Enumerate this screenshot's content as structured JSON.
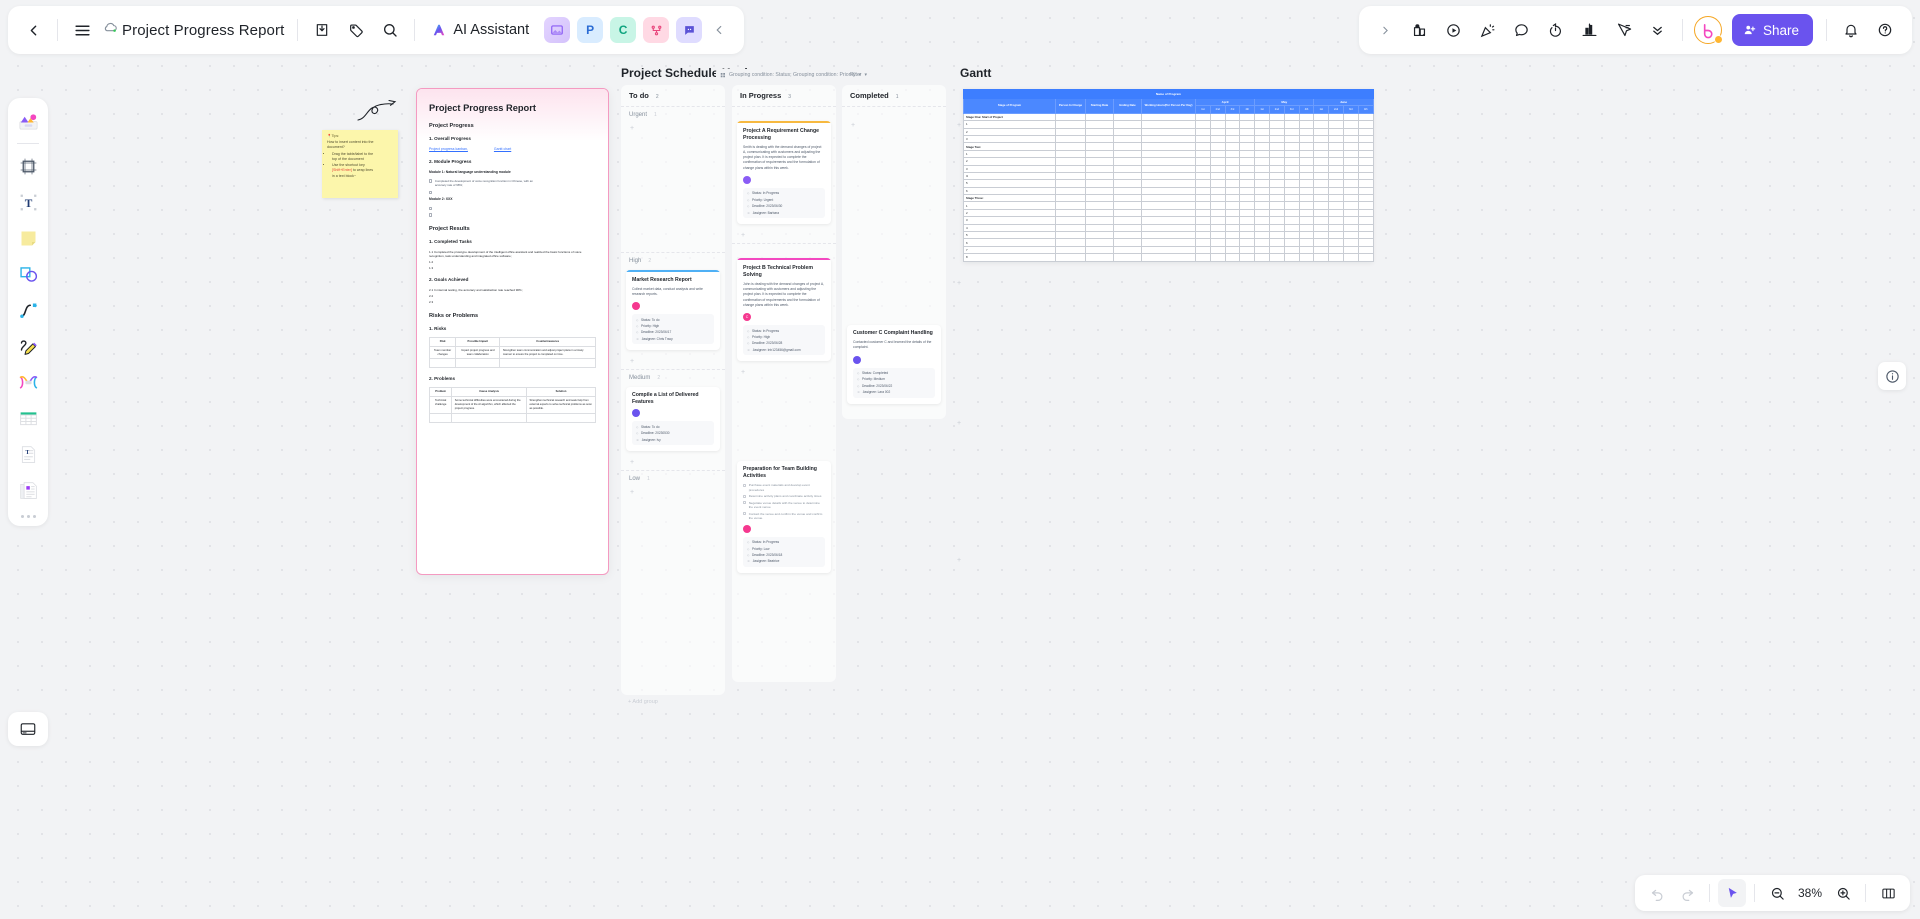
{
  "topbar": {
    "back_icon": "chevron-left-icon",
    "menu_icon": "hamburger-menu-icon",
    "cloud_icon": "cloud-sync-icon",
    "title": "Project Progress Report",
    "download_icon": "download-icon",
    "tag_icon": "tag-icon",
    "search_icon": "search-icon",
    "ai_label": "AI Assistant",
    "apps": [
      {
        "name": "app-image",
        "glyph": "◢"
      },
      {
        "name": "app-presentation",
        "glyph": "P"
      },
      {
        "name": "app-chart",
        "glyph": "C"
      },
      {
        "name": "app-mindmap",
        "glyph": "⑂"
      },
      {
        "name": "app-comment",
        "glyph": "••"
      }
    ],
    "collapse_icon": "chevron-left-icon",
    "right_expand_icon": "chevron-right-icon",
    "right_tools": [
      "sticker-icon",
      "play-circle-icon",
      "celebrate-icon",
      "comment-bubble-icon",
      "timer-icon",
      "presentation-chart-icon",
      "cursor-select-icon",
      "chevron-double-down-icon"
    ],
    "bot_icon": "bot-avatar",
    "share_label": "Share",
    "share_color": "#6a53ee",
    "bell_icon": "bell-icon",
    "help_icon": "help-circle-icon"
  },
  "tool_rail": {
    "items": [
      {
        "name": "templates-tool",
        "label": "Templates"
      },
      {
        "name": "frame-tool",
        "label": "Frame"
      },
      {
        "name": "text-tool",
        "label": "Text"
      },
      {
        "name": "sticky-note-tool",
        "label": "Sticky note"
      },
      {
        "name": "shape-tool",
        "label": "Shape"
      },
      {
        "name": "connector-tool",
        "label": "Connector"
      },
      {
        "name": "pen-tool",
        "label": "Pen"
      },
      {
        "name": "mindmap-tool",
        "label": "Mind map"
      },
      {
        "name": "table-tool",
        "label": "Table"
      },
      {
        "name": "document-tool",
        "label": "Document"
      },
      {
        "name": "more-apps-tool",
        "label": "More"
      }
    ],
    "more_icon": "three-dots-icon",
    "bottom_icon": "layers-panel-icon",
    "info_icon": "info-circle-icon"
  },
  "sticky_note": {
    "head": "📍Tips:",
    "line1": "How to insert content into the",
    "line2": "document?",
    "bullets": [
      {
        "pre": "Drag the table/label to the",
        "post": "top of the document"
      },
      {
        "pre": "Use the shortcut key",
        "key": "[Shift+Enter]",
        "post": " to wrap lines",
        "post2": "in a text block~"
      }
    ]
  },
  "document": {
    "title": "Project Progress Report",
    "h_progress": "Project Progress",
    "s1": "1. Overall Progress",
    "link1": "Project progress kanban,",
    "link2": "Gantt chart",
    "s2": "2. Module Progress",
    "module1": "Module 1: Natural language understanding module",
    "task1_a": "Completed the development of voice recognition function in Chinese, with an",
    "task1_b": "accuracy rate of 98%;",
    "module2": "Module 2: XXX",
    "h_results": "Project Results",
    "r1": "1. Completed Tasks",
    "r11": "1.1 Completed the prototype development of the intelligent office assistant and realized the basic functions of voice recognition, task understanding and integrated office software;",
    "r12": "1.2",
    "r13": "1.3",
    "r2": "2. Goals Achieved",
    "r21": "2.1 In internal testing, the accuracy and satisfaction rate reached 90%;",
    "r22": "2.2",
    "r23": "2.3",
    "h_risks": "Risks or Problems",
    "k1": "1. Risks",
    "risk_table": {
      "headers": [
        "Risk",
        "Possible Impact",
        "Countermeasures"
      ],
      "rows": [
        [
          "Team member changes",
          "Impact project progress and team collaboration",
          "Strengthen team communication and adjust project plans in a timely manner to ensure the project is completed on time."
        ],
        [
          "",
          "",
          ""
        ]
      ]
    },
    "k2": "2. Problems",
    "problem_table": {
      "headers": [
        "Problem",
        "Cause Analysis",
        "Solution"
      ],
      "rows": [
        [
          "Technical challenge",
          "Some technical difficulties were encountered during the development of the AI algorithm, which affected the project progress.",
          "Strengthen technical research and seek help from external experts to solve technical problems as soon as possible."
        ],
        [
          "",
          "",
          ""
        ]
      ]
    }
  },
  "kanban": {
    "title": "Project Schedule Kanban",
    "grouping_chip": "Grouping condition: Status; Grouping condition: Priority",
    "grouping_icon": "grouping-icon",
    "filter_label": "Filter",
    "add_group_label": "+ Add group",
    "columns": [
      {
        "name": "to-do",
        "title": "To do",
        "count": "2",
        "groups": [
          {
            "label": "Urgent",
            "count": "1",
            "cards": []
          },
          {
            "label": "High",
            "count": "2",
            "cards": [
              {
                "title": "Market Research Report",
                "desc": "Collect market data, conduct analysis and write research reports.",
                "accent": "#4fb0f5",
                "avatar_color": "#f5388f",
                "avatar_glyph": "◉",
                "meta": [
                  "Status: To do",
                  "Priority: High",
                  "Deadline: 2023/06/17",
                  "Assignee: Chris Tracy"
                ]
              }
            ]
          },
          {
            "label": "Medium",
            "count": "2",
            "cards": [
              {
                "title": "Compile a List of Delivered Features",
                "desc": "",
                "accent": "#ffffff",
                "avatar_color": "#6a53ee",
                "avatar_glyph": "▣",
                "meta": [
                  "Status: To do",
                  "Deadline: 20230530",
                  "Assignee: Ivy"
                ]
              }
            ]
          },
          {
            "label": "Low",
            "count": "1",
            "cards": []
          }
        ]
      },
      {
        "name": "in-progress",
        "title": "In Progress",
        "count": "3",
        "groups": [
          {
            "label": "",
            "count": "",
            "cards": [
              {
                "title": "Project A Requirement Change Processing",
                "desc": "Smith is dealing with the demand changes of project A, communicating with customers and adjusting the project plan. It is expected to complete the confirmation of requirements and the formulation of change plans within this week.",
                "accent": "#f7b940",
                "avatar_color": "#8a5cf5",
                "avatar_glyph": "▣",
                "meta": [
                  "Status: In Progress",
                  "Priority: Urgent",
                  "Deadline: 2023/06/30",
                  "Assignee: Barbara"
                ]
              }
            ]
          },
          {
            "label": "",
            "count": "",
            "cards": [
              {
                "title": "Project B Technical Problem Solving",
                "desc": "John is dealing with the demand changes of project A, communicating with customers and adjusting the project plan. It is expected to complete the confirmation of requirements and the formulation of change plans within this week.",
                "accent": "#f348c0",
                "avatar_color": "#f5388f",
                "avatar_glyph": "C",
                "meta": [
                  "Status: In Progress",
                  "Priority: High",
                  "Deadline: 2023/06/28",
                  "Assignee: Intr123456@gmail.com"
                ]
              }
            ]
          },
          {
            "label": "",
            "count": "",
            "cards": [
              {
                "title": "Preparation for Team Building Activities",
                "desc": "",
                "accent": "#ffffff",
                "avatar_color": "#f5388f",
                "avatar_glyph": "◉",
                "todos": [
                  "Purchase event materials and develop event procedures",
                  "Determine activity plans and coordinate activity times",
                  "Negotiate venue details with the venue to determine the event venue",
                  "Contact the venue and confirm the venue and confirm the venue."
                ],
                "meta": [
                  "Status: In Progress",
                  "Priority: Low",
                  "Deadline: 2023/06/18",
                  "Assignee: Beatrice"
                ]
              }
            ]
          }
        ]
      },
      {
        "name": "completed",
        "title": "Completed",
        "count": "1",
        "groups": [
          {
            "label": "",
            "count": "",
            "cards": []
          },
          {
            "label": "",
            "count": "",
            "cards": [
              {
                "title": "Customer C Complaint Handling",
                "desc": "Contacted customer C and learned the details of the complaint.",
                "accent": "#ffffff",
                "avatar_color": "#6a53ee",
                "avatar_glyph": "▣",
                "meta": [
                  "Status: Completed",
                  "Priority: Medium",
                  "Deadline: 2023/06/22",
                  "Assignee: Lara 002"
                ]
              }
            ]
          }
        ]
      }
    ]
  },
  "gantt": {
    "title": "Gantt",
    "banner": "Name of Program",
    "headers": [
      "Stage of Program",
      "Person In Charge",
      "Starting Date",
      "Ending Date",
      "Working Hours(Per Person Per Day)"
    ],
    "months": [
      "April",
      "May",
      "June"
    ],
    "ticks": [
      "1st",
      "2nd",
      "3rd",
      "4th",
      "1st",
      "2nd",
      "3rd",
      "4th",
      "1st",
      "2nd",
      "3rd",
      "4th"
    ],
    "rows": [
      {
        "type": "stage",
        "label": "Stage One: Start of Project"
      },
      {
        "type": "item",
        "label": "1"
      },
      {
        "type": "item",
        "label": "2"
      },
      {
        "type": "item",
        "label": "3"
      },
      {
        "type": "stage",
        "label": "Stage Two:"
      },
      {
        "type": "item",
        "label": "1"
      },
      {
        "type": "item",
        "label": "2"
      },
      {
        "type": "item",
        "label": "3"
      },
      {
        "type": "item",
        "label": "4",
        "bold": true
      },
      {
        "type": "item",
        "label": "5"
      },
      {
        "type": "item",
        "label": "6"
      },
      {
        "type": "stage",
        "label": "Stage Three:"
      },
      {
        "type": "item",
        "label": "1"
      },
      {
        "type": "item",
        "label": "2"
      },
      {
        "type": "item",
        "label": "3"
      },
      {
        "type": "item",
        "label": "4"
      },
      {
        "type": "item",
        "label": "5"
      },
      {
        "type": "item",
        "label": "6"
      },
      {
        "type": "item",
        "label": "7"
      },
      {
        "type": "item",
        "label": "8"
      }
    ]
  },
  "bottombar": {
    "undo_icon": "undo-icon",
    "redo_icon": "redo-icon",
    "cursor_icon": "cursor-pointer-icon",
    "zoom_out_icon": "zoom-out-icon",
    "zoom_value": "38%",
    "zoom_in_icon": "zoom-in-icon",
    "fit_icon": "fit-screen-icon"
  }
}
